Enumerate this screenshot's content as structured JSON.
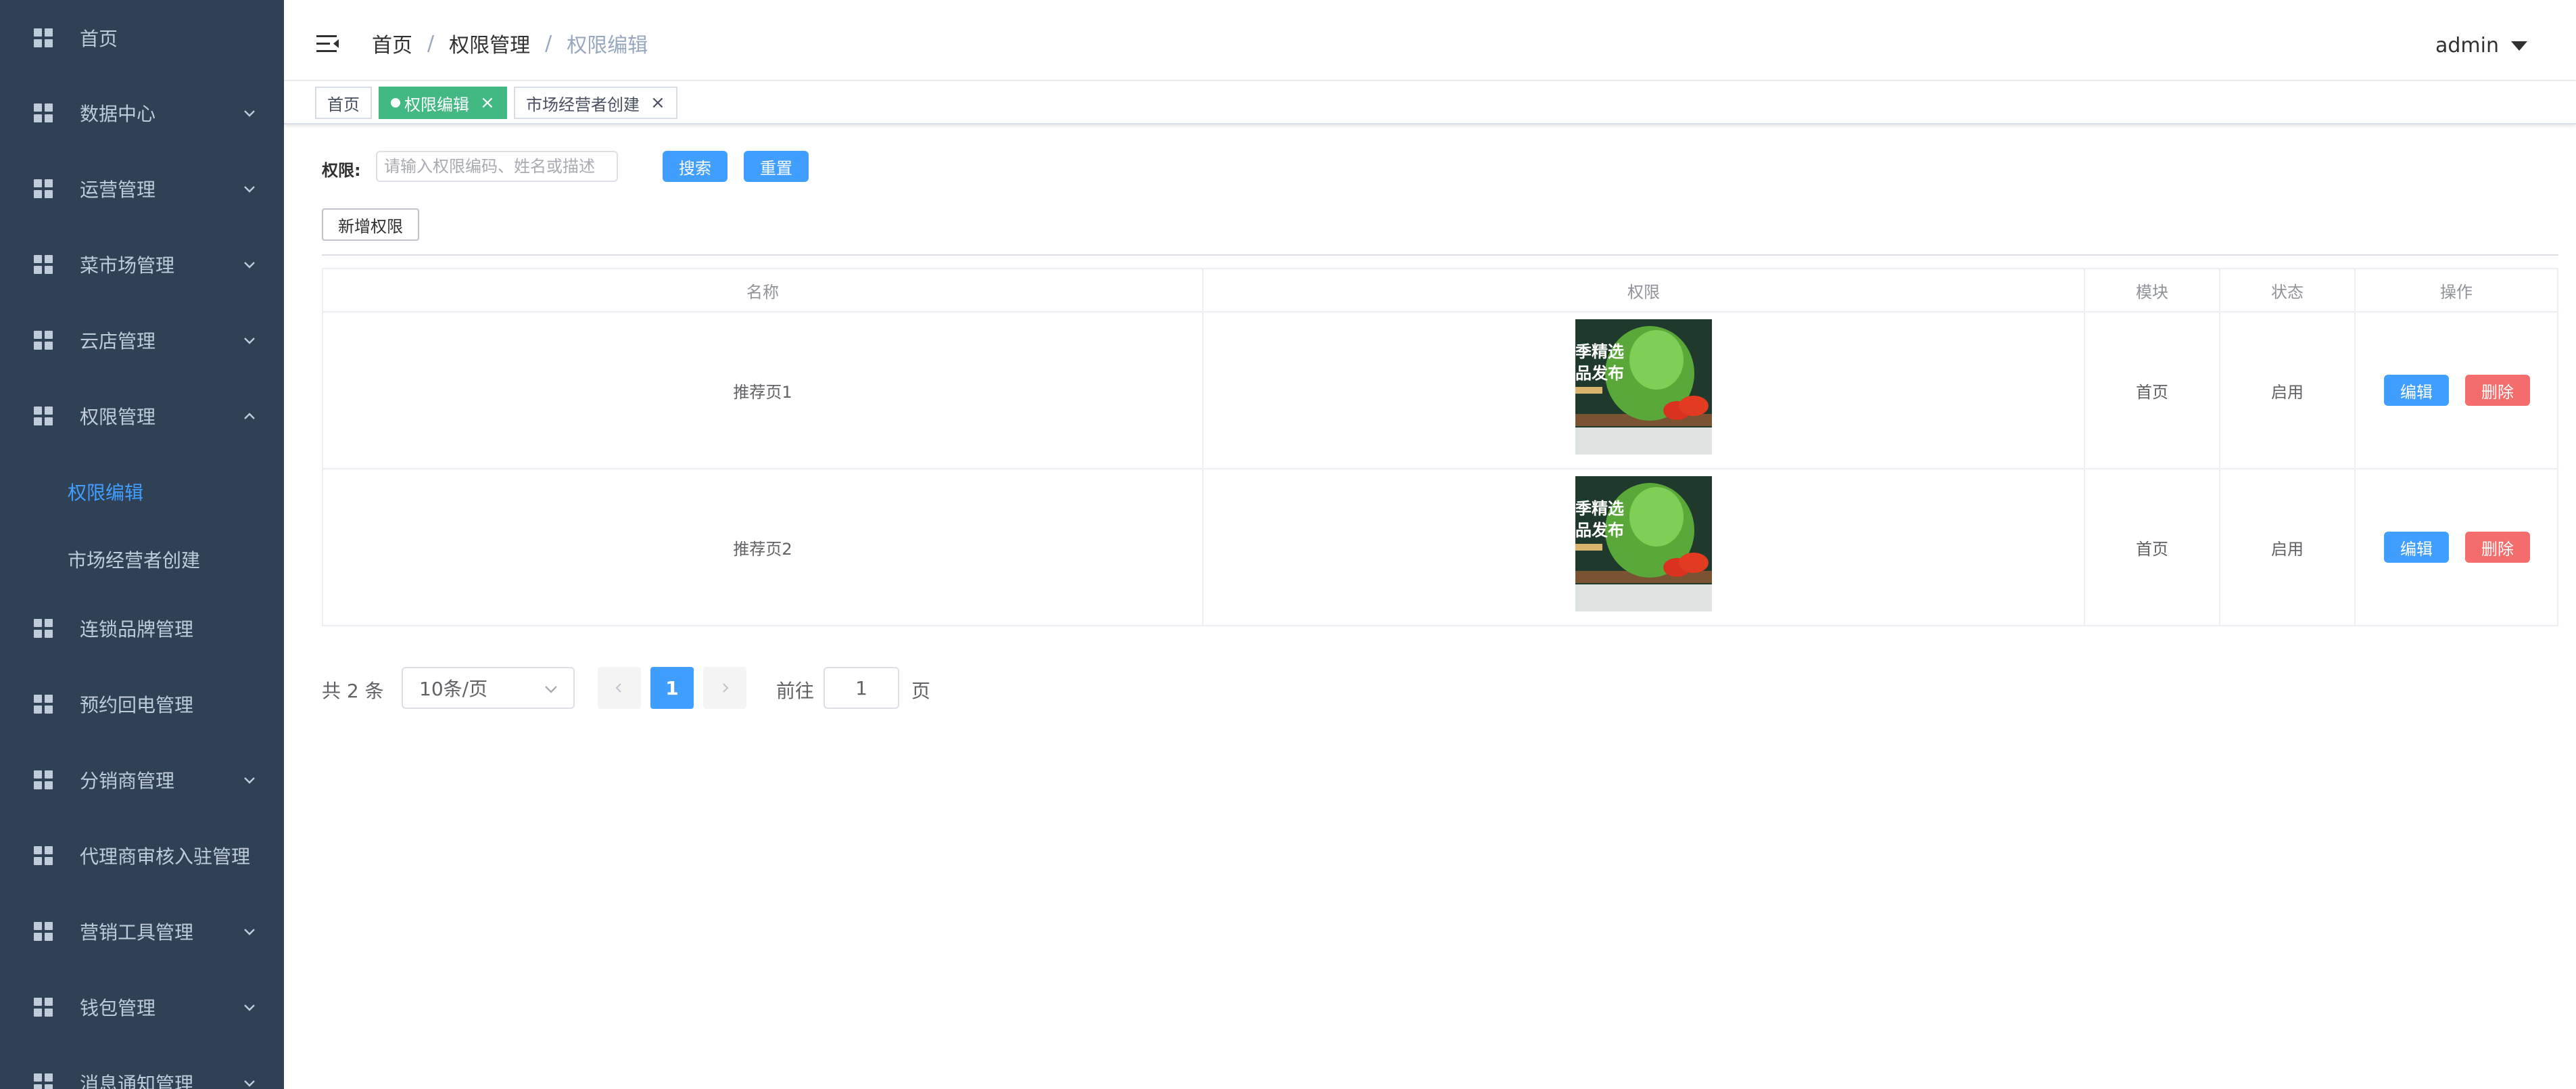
{
  "sidebar": {
    "items": [
      {
        "label": "首页",
        "expandable": false
      },
      {
        "label": "数据中心",
        "expandable": true
      },
      {
        "label": "运营管理",
        "expandable": true
      },
      {
        "label": "菜市场管理",
        "expandable": true
      },
      {
        "label": "云店管理",
        "expandable": true
      },
      {
        "label": "权限管理",
        "expandable": true,
        "expanded": true
      },
      {
        "label": "连锁品牌管理",
        "expandable": false
      },
      {
        "label": "预约回电管理",
        "expandable": false
      },
      {
        "label": "分销商管理",
        "expandable": true
      },
      {
        "label": "代理商审核入驻管理",
        "expandable": false
      },
      {
        "label": "营销工具管理",
        "expandable": true
      },
      {
        "label": "钱包管理",
        "expandable": true
      },
      {
        "label": "消息通知管理",
        "expandable": true
      }
    ],
    "submenu": [
      {
        "label": "权限编辑",
        "active": true
      },
      {
        "label": "市场经营者创建",
        "active": false
      }
    ],
    "background": "#304156",
    "active_color": "#409eff"
  },
  "header": {
    "breadcrumb": [
      "首页",
      "权限管理",
      "权限编辑"
    ],
    "separator": "/",
    "user": "admin"
  },
  "tags": [
    {
      "label": "首页",
      "active": false
    },
    {
      "label": "权限编辑",
      "active": true
    },
    {
      "label": "市场经营者创建",
      "active": false
    }
  ],
  "filter": {
    "label": "权限:",
    "placeholder": "请输入权限编码、姓名或描述",
    "search_label": "搜索",
    "reset_label": "重置",
    "add_label": "新增权限"
  },
  "table": {
    "columns": [
      "名称",
      "权限",
      "模块",
      "状态",
      "操作"
    ],
    "rows": [
      {
        "name": "推荐页1",
        "image_caption": [
          "季精选",
          "品发布"
        ],
        "module": "首页",
        "status": "启用"
      },
      {
        "name": "推荐页2",
        "image_caption": [
          "季精选",
          "品发布"
        ],
        "module": "首页",
        "status": "启用"
      }
    ],
    "edit_label": "编辑",
    "delete_label": "删除"
  },
  "pagination": {
    "total_text": "共 2 条",
    "page_size": "10条/页",
    "current_page": "1",
    "goto_label": "前往",
    "goto_value": "1",
    "page_suffix": "页"
  },
  "colors": {
    "primary": "#409eff",
    "danger": "#f56c6c",
    "tag_active": "#42b983"
  }
}
